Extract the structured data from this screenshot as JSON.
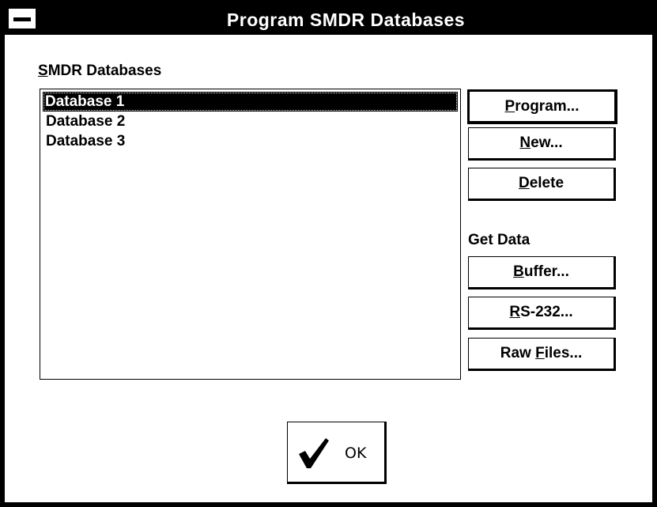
{
  "window": {
    "title": "Program SMDR Databases"
  },
  "databases": {
    "label_first": "S",
    "label_rest": "MDR Databases",
    "items": [
      "Database 1",
      "Database 2",
      "Database 3"
    ],
    "selected_index": 0
  },
  "buttons": {
    "program": {
      "accel": "P",
      "rest": "rogram..."
    },
    "new": {
      "accel": "N",
      "rest": "ew..."
    },
    "delete": {
      "accel": "D",
      "rest": "elete"
    }
  },
  "get_data": {
    "label": "Get Data",
    "buffer": {
      "accel": "B",
      "rest": "uffer..."
    },
    "rs232": {
      "accel": "R",
      "rest": "S-232..."
    },
    "raw_files": {
      "prefix": "Raw ",
      "accel": "F",
      "rest": "iles..."
    }
  },
  "ok": {
    "label": "OK",
    "icon": "checkmark-icon"
  }
}
